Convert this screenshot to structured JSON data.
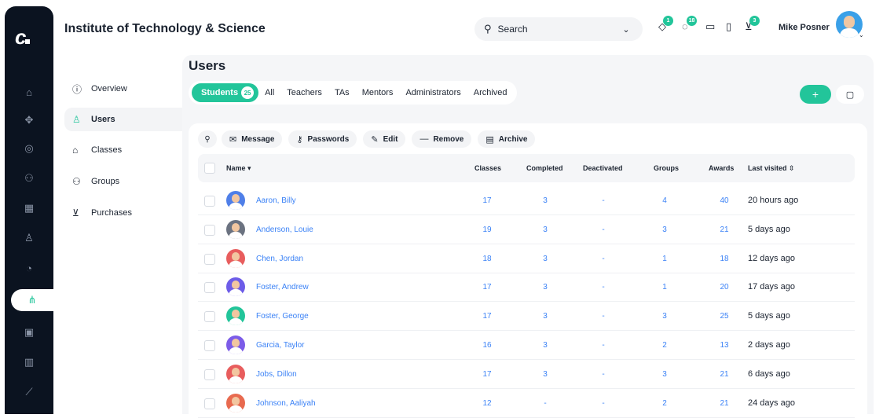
{
  "header": {
    "org_title": "Institute of Technology & Science",
    "search_placeholder": "Search",
    "user_name": "Mike Posner",
    "badges": {
      "notifications": "1",
      "chat": "18",
      "cart": "3"
    }
  },
  "rail": {
    "items": [
      "home-icon",
      "apps-icon",
      "globe-icon",
      "people-icon",
      "grid-icon",
      "user-icon",
      "pie-icon",
      "org-chart-icon",
      "calendar-icon",
      "library-icon",
      "analytics-icon"
    ]
  },
  "subnav": {
    "items": [
      {
        "label": "Overview",
        "icon": "info-icon"
      },
      {
        "label": "Users",
        "icon": "user-icon"
      },
      {
        "label": "Classes",
        "icon": "class-icon"
      },
      {
        "label": "Groups",
        "icon": "groups-icon"
      },
      {
        "label": "Purchases",
        "icon": "cart-icon"
      }
    ]
  },
  "main": {
    "title": "Users",
    "tabs": [
      {
        "label": "Students",
        "count": "25"
      },
      {
        "label": "All"
      },
      {
        "label": "Teachers"
      },
      {
        "label": "TAs"
      },
      {
        "label": "Mentors"
      },
      {
        "label": "Administrators"
      },
      {
        "label": "Archived"
      }
    ],
    "add_label": "+",
    "toolbar": {
      "message": "Message",
      "passwords": "Passwords",
      "edit": "Edit",
      "remove": "Remove",
      "archive": "Archive"
    },
    "table": {
      "columns": {
        "name": "Name",
        "classes": "Classes",
        "completed": "Completed",
        "deactivated": "Deactivated",
        "groups": "Groups",
        "awards": "Awards",
        "last_visited": "Last visited"
      },
      "rows": [
        {
          "name": "Aaron, Billy",
          "classes": "17",
          "completed": "3",
          "deactivated": "-",
          "groups": "4",
          "awards": "40",
          "last_visited": "20 hours ago",
          "color": "#4f7fe8"
        },
        {
          "name": "Anderson, Louie",
          "classes": "19",
          "completed": "3",
          "deactivated": "-",
          "groups": "3",
          "awards": "21",
          "last_visited": "5 days ago",
          "color": "#6b7280"
        },
        {
          "name": "Chen, Jordan",
          "classes": "18",
          "completed": "3",
          "deactivated": "-",
          "groups": "1",
          "awards": "18",
          "last_visited": "12 days ago",
          "color": "#e85d5d"
        },
        {
          "name": "Foster, Andrew",
          "classes": "17",
          "completed": "3",
          "deactivated": "-",
          "groups": "1",
          "awards": "20",
          "last_visited": "17 days ago",
          "color": "#6d5ce8"
        },
        {
          "name": "Foster, George",
          "classes": "17",
          "completed": "3",
          "deactivated": "-",
          "groups": "3",
          "awards": "25",
          "last_visited": "5 days ago",
          "color": "#22c59a"
        },
        {
          "name": "Garcia, Taylor",
          "classes": "16",
          "completed": "3",
          "deactivated": "-",
          "groups": "2",
          "awards": "13",
          "last_visited": "2 days ago",
          "color": "#7c5ce8"
        },
        {
          "name": "Jobs, Dillon",
          "classes": "17",
          "completed": "3",
          "deactivated": "-",
          "groups": "3",
          "awards": "21",
          "last_visited": "6 days ago",
          "color": "#e85d5d"
        },
        {
          "name": "Johnson, Aaliyah",
          "classes": "12",
          "completed": "-",
          "deactivated": "-",
          "groups": "2",
          "awards": "21",
          "last_visited": "24 days ago",
          "color": "#e86a4f"
        }
      ]
    }
  },
  "colors": {
    "accent": "#22c59a",
    "rail": "#0b1320",
    "link": "#3b82f6"
  }
}
